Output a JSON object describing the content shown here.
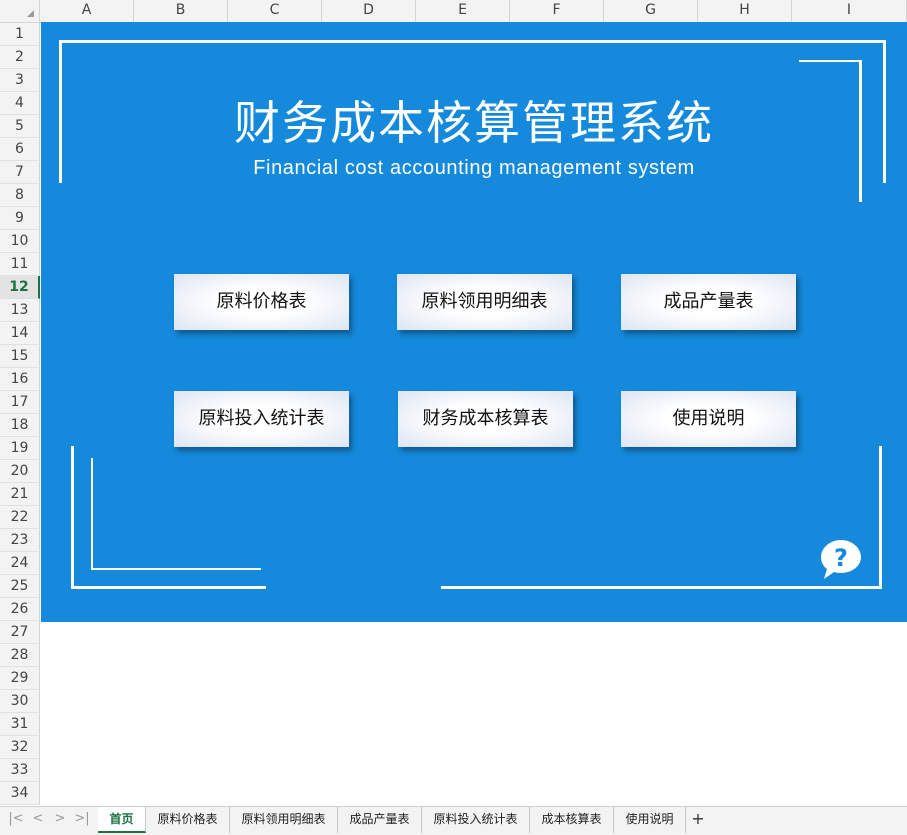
{
  "columns": [
    "A",
    "B",
    "C",
    "D",
    "E",
    "F",
    "G",
    "H",
    "I"
  ],
  "rows": [
    "1",
    "2",
    "3",
    "4",
    "5",
    "6",
    "7",
    "8",
    "9",
    "10",
    "11",
    "12",
    "13",
    "14",
    "15",
    "16",
    "17",
    "18",
    "19",
    "20",
    "21",
    "22",
    "23",
    "24",
    "25",
    "26",
    "27",
    "28",
    "29",
    "30",
    "31",
    "32",
    "33",
    "34"
  ],
  "active_row": "12",
  "banner": {
    "title": "财务成本核算管理系统",
    "subtitle": "Financial cost accounting management system",
    "buttons": [
      "原料价格表",
      "原料领用明细表",
      "成品产量表",
      "原料投入统计表",
      "财务成本核算表",
      "使用说明"
    ]
  },
  "tabs": [
    "首页",
    "原料价格表",
    "原料领用明细表",
    "成品产量表",
    "原料投入统计表",
    "成本核算表",
    "使用说明"
  ],
  "active_tab": "首页",
  "colors": {
    "banner": "#1589dc",
    "accent": "#1e7145"
  }
}
